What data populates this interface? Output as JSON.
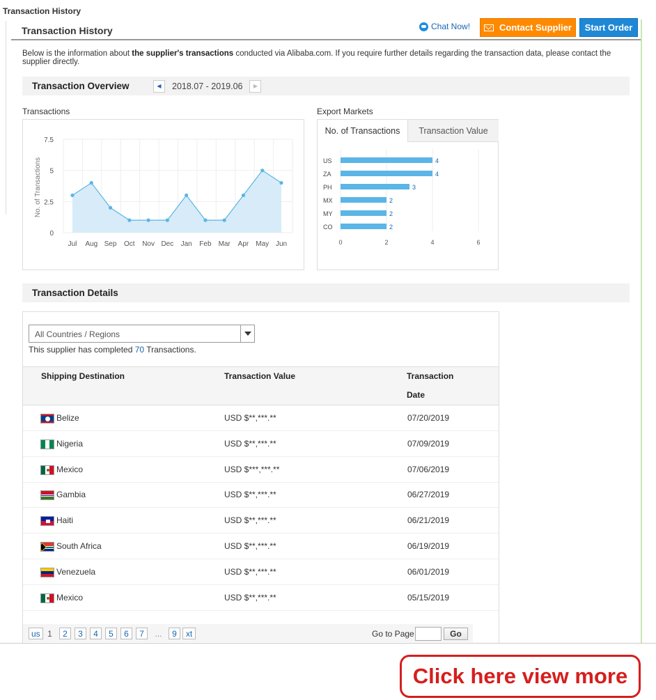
{
  "page": {
    "crumb_title": "Transaction History",
    "panel_title": "Transaction History",
    "chat_label": "Chat Now!",
    "contact_label": "Contact Supplier",
    "start_order_label": "Start Order",
    "intro_before": "Below is the information about ",
    "intro_bold": "the supplier's transactions",
    "intro_after": " conducted via Alibaba.com. If you require further details regarding the transaction data, please contact the supplier directly.",
    "view_more_label": "Click here view more"
  },
  "overview": {
    "title": "Transaction Overview",
    "range": "2018.07 - 2019.06",
    "left_arrow": "◀",
    "right_arrow": "▶"
  },
  "charts": {
    "transactions_label": "Transactions",
    "export_label": "Export Markets",
    "tab_active": "No. of Transactions",
    "tab_inactive": "Transaction Value",
    "ylabel": "No. of Transactions"
  },
  "chart_data": [
    {
      "type": "area",
      "title": "Transactions",
      "ylabel": "No. of Transactions",
      "ylim": [
        0,
        7.5
      ],
      "yticks": [
        "7.5",
        "5",
        "2.5",
        "0"
      ],
      "categories": [
        "Jul",
        "Aug",
        "Sep",
        "Oct",
        "Nov",
        "Dec",
        "Jan",
        "Feb",
        "Mar",
        "Apr",
        "May",
        "Jun"
      ],
      "values": [
        3,
        4,
        2,
        1,
        1,
        1,
        3,
        1,
        1,
        3,
        5,
        4
      ],
      "color": "#5bb5e6",
      "fill": "#d7ecf8"
    },
    {
      "type": "bar",
      "title": "Export Markets",
      "orientation": "horizontal",
      "categories": [
        "US",
        "ZA",
        "PH",
        "MX",
        "MY",
        "CO"
      ],
      "values": [
        4,
        4,
        3,
        2,
        2,
        2
      ],
      "xticks": [
        "0",
        "2",
        "4",
        "6"
      ],
      "xlim": [
        0,
        6
      ],
      "color": "#5bb5e6"
    }
  ],
  "details": {
    "title": "Transaction Details",
    "select_value": "All Countries / Regions",
    "completed_before": "This supplier has completed ",
    "completed_count": "70",
    "completed_after": " Transactions.",
    "col_destination": "Shipping Destination",
    "col_value": "Transaction Value",
    "col_date_1": "Transaction",
    "col_date_2": "Date",
    "rows": [
      {
        "country": "Belize",
        "value": "USD $**,***.**",
        "date": "07/20/2019",
        "flag": "belize"
      },
      {
        "country": "Nigeria",
        "value": "USD $**,***.**",
        "date": "07/09/2019",
        "flag": "nigeria"
      },
      {
        "country": "Mexico",
        "value": "USD $***,***.**",
        "date": "07/06/2019",
        "flag": "mexico"
      },
      {
        "country": "Gambia",
        "value": "USD $**,***.**",
        "date": "06/27/2019",
        "flag": "gambia"
      },
      {
        "country": "Haiti",
        "value": "USD $**,***.**",
        "date": "06/21/2019",
        "flag": "haiti"
      },
      {
        "country": "South Africa",
        "value": "USD $**,***.**",
        "date": "06/19/2019",
        "flag": "south-africa"
      },
      {
        "country": "Venezuela",
        "value": "USD $**,***.**",
        "date": "06/01/2019",
        "flag": "venezuela"
      },
      {
        "country": "Mexico",
        "value": "USD $**,***.**",
        "date": "05/15/2019",
        "flag": "mexico"
      }
    ]
  },
  "pager": {
    "prev": "us",
    "pages": [
      "1",
      "2",
      "3",
      "4",
      "5",
      "6",
      "7"
    ],
    "dots": "...",
    "last": "9",
    "next": "xt",
    "goto_label": "Go to Page",
    "go_label": "Go"
  }
}
